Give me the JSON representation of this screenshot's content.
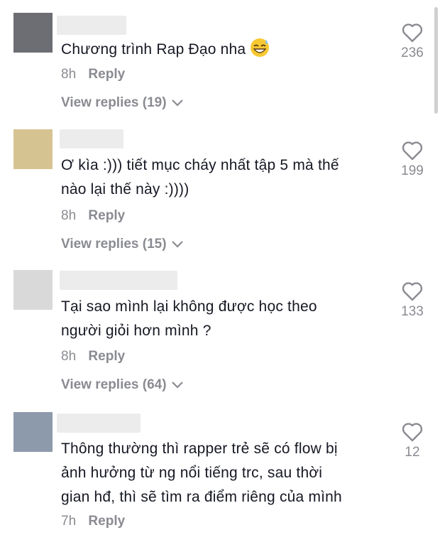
{
  "comments": [
    {
      "avatar_color": "#6d6e73",
      "text": "Chương trình Rap Đạo nha",
      "has_emoji": true,
      "time": "8h",
      "reply_label": "Reply",
      "view_replies": "View replies (19)",
      "likes": "236"
    },
    {
      "avatar_color": "#d6c392",
      "text_line1": "Ơ kìa :))) tiết mục cháy nhất tập 5 mà thế",
      "text_line2": "nào lại thế này :))))",
      "time": "8h",
      "reply_label": "Reply",
      "view_replies": "View replies (15)",
      "likes": "199"
    },
    {
      "avatar_color": "#d9d9d9",
      "text_line1": "Tại sao mình lại không được học theo",
      "text_line2": "người giỏi hơn mình ?",
      "time": "8h",
      "reply_label": "Reply",
      "view_replies": "View replies (64)",
      "likes": "133"
    },
    {
      "avatar_color": "#8d9aab",
      "text_line1": "Thông thường thì rapper trẻ sẽ có flow bị",
      "text_line2": "ảnh hưởng từ ng nổi tiếng trc, sau thời",
      "text_line3": "gian hđ, thì sẽ tìm ra điểm riêng của mình",
      "time": "7h",
      "reply_label": "Reply",
      "likes": "12"
    }
  ],
  "icons": {
    "like": "heart-outline-icon",
    "expand": "chevron-down-icon",
    "emoji": "grinning-sweat-emoji"
  }
}
